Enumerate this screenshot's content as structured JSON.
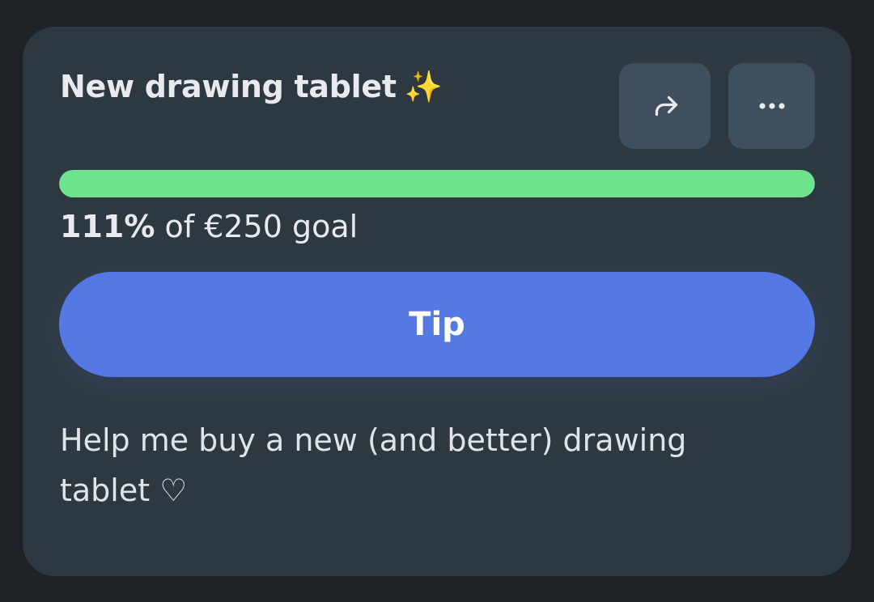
{
  "card": {
    "title": "New drawing tablet",
    "title_emoji": "✨",
    "share_icon": "share-arrow-icon",
    "more_icon": "more-dots-icon",
    "progress": {
      "percent_label": "111%",
      "goal_label": " of €250 goal",
      "fill_fraction": 1.0,
      "fill_color": "#6ee38e"
    },
    "tip_label": "Tip",
    "description": "Help me buy a new (and better) drawing tablet ♡"
  },
  "colors": {
    "background": "#1e2226",
    "card": "#2e3841",
    "accent": "#5479e4",
    "button_bg": "#3e4f5e"
  }
}
